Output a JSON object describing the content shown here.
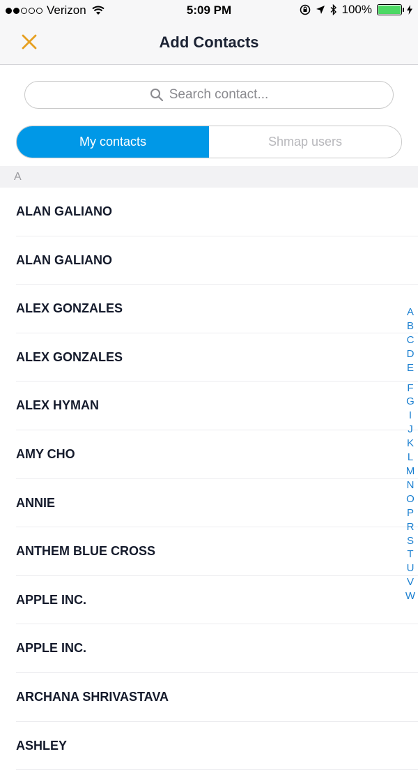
{
  "status": {
    "carrier": "Verizon",
    "time": "5:09 PM",
    "battery": "100%",
    "signal_bars": 2
  },
  "header": {
    "title": "Add Contacts",
    "close_icon": "close-icon",
    "close_color": "#e6a022"
  },
  "search": {
    "placeholder": "Search contact..."
  },
  "tabs": {
    "active_label": "My contacts",
    "inactive_label": "Shmap users",
    "active_color": "#0098e7"
  },
  "section": {
    "letter": "A"
  },
  "contacts": [
    "ALAN GALIANO",
    "ALAN GALIANO",
    "ALEX GONZALES",
    "ALEX GONZALES",
    "ALEX HYMAN",
    "AMY CHO",
    "ANNIE",
    "ANTHEM BLUE CROSS",
    "APPLE INC.",
    "APPLE INC.",
    "ARCHANA SHRIVASTAVA",
    "ASHLEY"
  ],
  "index_letters": [
    "A",
    "B",
    "C",
    "D",
    "E",
    "F",
    "G",
    "I",
    "J",
    "K",
    "L",
    "M",
    "N",
    "O",
    "P",
    "R",
    "S",
    "T",
    "U",
    "V",
    "W"
  ]
}
